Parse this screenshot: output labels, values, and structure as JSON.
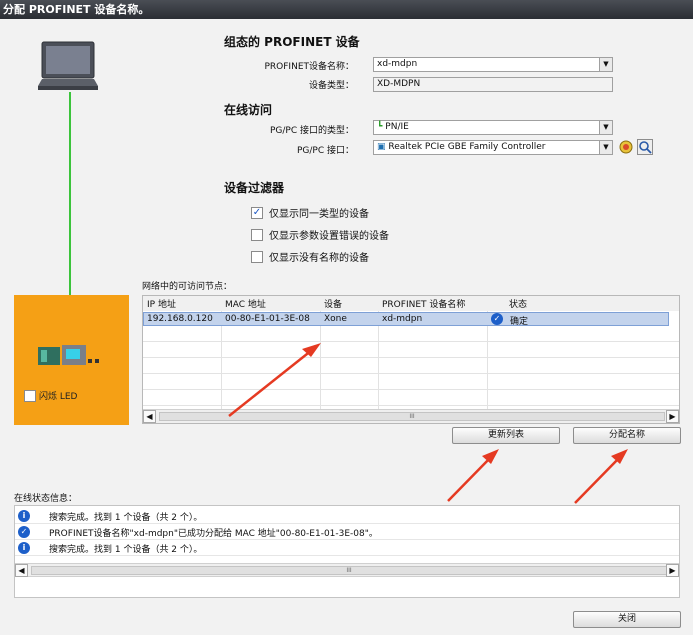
{
  "title": "分配 PROFINET 设备名称。",
  "device_panel": {
    "led_label": "闪烁 LED"
  },
  "configured": {
    "heading": "组态的 PROFINET 设备",
    "name_label": "PROFINET设备名称：",
    "name_value": "xd-mdpn",
    "type_label": "设备类型：",
    "type_value": "XD-MDPN"
  },
  "online_access": {
    "heading": "在线访问",
    "iface_type_label": "PG/PC 接口的类型：",
    "iface_type_value": "PN/IE",
    "iface_label": "PG/PC 接口：",
    "iface_value": "Realtek PCIe GBE Family Controller"
  },
  "filter": {
    "heading": "设备过滤器",
    "options": [
      {
        "label": "仅显示同一类型的设备",
        "checked": true
      },
      {
        "label": "仅显示参数设置错误的设备",
        "checked": false
      },
      {
        "label": "仅显示没有名称的设备",
        "checked": false
      }
    ]
  },
  "nodes": {
    "label": "网络中的可访问节点：",
    "columns": [
      "IP 地址",
      "MAC 地址",
      "设备",
      "PROFINET 设备名称",
      "状态"
    ],
    "rows": [
      {
        "ip": "192.168.0.120",
        "mac": "00-80-E1-01-3E-08",
        "device": "Xone",
        "name": "xd-mdpn",
        "status": "确定"
      }
    ],
    "scroll_thumb": "III"
  },
  "buttons": {
    "refresh": "更新列表",
    "assign": "分配名称",
    "close": "关闭"
  },
  "status": {
    "label": "在线状态信息：",
    "rows": [
      {
        "icon": "info",
        "text": "搜索完成。找到 1 个设备（共 2 个）。"
      },
      {
        "icon": "check",
        "text": "PROFINET设备名称\"xd-mdpn\"已成功分配给 MAC 地址\"00-80-E1-01-3E-08\"。"
      },
      {
        "icon": "info",
        "text": "搜索完成。找到 1 个设备（共 2 个）。"
      }
    ],
    "scroll_thumb": "III"
  },
  "colors": {
    "device_panel": "#f5a015",
    "link_line": "#3cc43c",
    "selection": "#c3d3ec",
    "arrow": "#e53a22",
    "info_icon": "#1d5fc9"
  }
}
